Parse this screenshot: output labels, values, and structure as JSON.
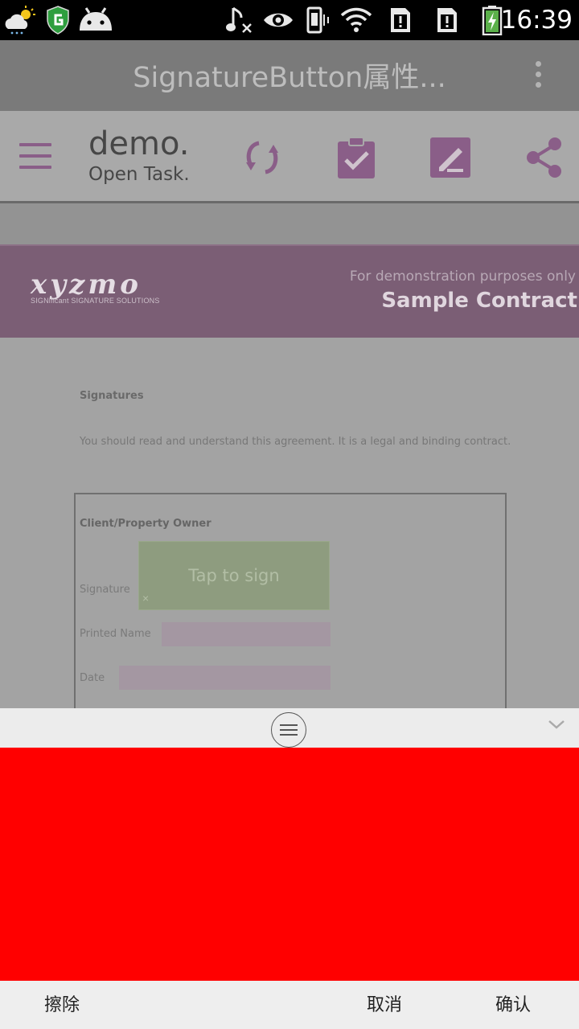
{
  "status_bar": {
    "time": "16:39",
    "icons": [
      "weather-rain-icon",
      "shield-g-icon",
      "android-icon",
      "music-muted-icon",
      "eye-icon",
      "vibrate-icon",
      "wifi-icon",
      "sim-1-alert-icon",
      "sim-2-alert-icon",
      "battery-charging-icon"
    ]
  },
  "app_bar": {
    "title": "SignatureButton属性...",
    "more_icon": "overflow-menu-icon"
  },
  "toolbar": {
    "logo_line1": "demo.",
    "logo_line2": "Open Task.",
    "icons": [
      "menu-icon",
      "sync-icon",
      "clipboard-check-icon",
      "edit-icon",
      "share-icon"
    ],
    "accent_color": "#8a5e88"
  },
  "document": {
    "banner": {
      "brand": "xyzmo",
      "brand_sub": "SIGNificant SIGNATURE SOLUTIONS",
      "note": "For demonstration purposes only",
      "title": "Sample Contract"
    },
    "heading": "Signatures",
    "intro": "You should read and understand this agreement. It is a legal and binding contract.",
    "section_title": "Client/Property Owner",
    "signature_label": "Signature",
    "sign_button_label": "Tap to sign",
    "sign_button_close": "×",
    "printed_name_label": "Printed Name",
    "date_label": "Date"
  },
  "signature_panel": {
    "pad_color": "#ff0000",
    "handle_icon": "drag-handle-icon",
    "collapse_icon": "chevron-down-icon",
    "erase_label": "擦除",
    "cancel_label": "取消",
    "confirm_label": "确认"
  }
}
